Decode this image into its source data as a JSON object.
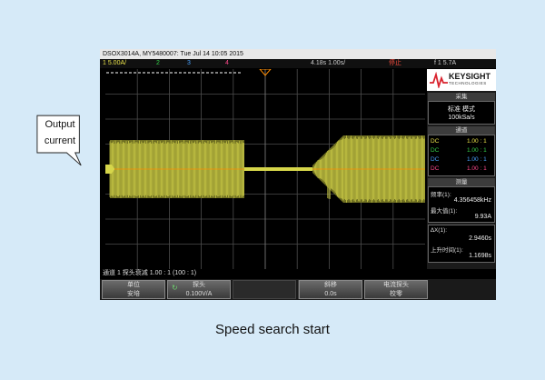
{
  "window": {
    "title": "DSOX3014A, MY5480007: Tue Jul 14 10:05 2015"
  },
  "statusbar": {
    "ch1_scale": "1  5.00A/",
    "ch2_marker": "2",
    "ch3_marker": "3",
    "ch4_marker": "4",
    "timebase": "4.18s  1.00s/",
    "run_state": "停止",
    "trigger": "f  1  5.7A"
  },
  "bottom_info": "通道 1 探头衰减 1.00 : 1 (100 : 1)",
  "softkeys": [
    {
      "line1": "单位",
      "line2": "安培"
    },
    {
      "line1": "探头",
      "line2": "0.100V/A"
    },
    {
      "line1": "斜移",
      "line2": "0.0s"
    },
    {
      "line1": "电流探头",
      "line2": "校零"
    }
  ],
  "side_panel": {
    "brand": "KEYSIGHT",
    "brand_sub": "TECHNOLOGIES",
    "acquisition": {
      "header": "采集",
      "mode": "标准 模式",
      "rate": "100kSa/s"
    },
    "channels": {
      "header": "通道",
      "rows": [
        {
          "left": "DC",
          "right": "1.00 : 1",
          "color": "#e8e04a"
        },
        {
          "left": "DC",
          "right": "1.00 : 1",
          "color": "#35d14a"
        },
        {
          "left": "DC",
          "right": "1.00 : 1",
          "color": "#4aa3ff"
        },
        {
          "left": "DC",
          "right": "1.00 : 1",
          "color": "#ff4a8c"
        }
      ]
    },
    "measurements": {
      "header": "测量",
      "items": [
        {
          "label": "频率(1):",
          "value": "4.356458kHz"
        },
        {
          "label": "最大值(1):",
          "value": "9.93A"
        },
        {
          "label": "∆X(1):",
          "value": "2.9460s"
        },
        {
          "label": "上升时间(1):",
          "value": "1.1698s"
        }
      ]
    }
  },
  "callout": {
    "line1": "Output",
    "line2": "current"
  },
  "caption": "Speed search start",
  "colors": {
    "trace": "#d6d64a",
    "ground_line": "#ff8c00",
    "background": "#d6eaf8"
  }
}
